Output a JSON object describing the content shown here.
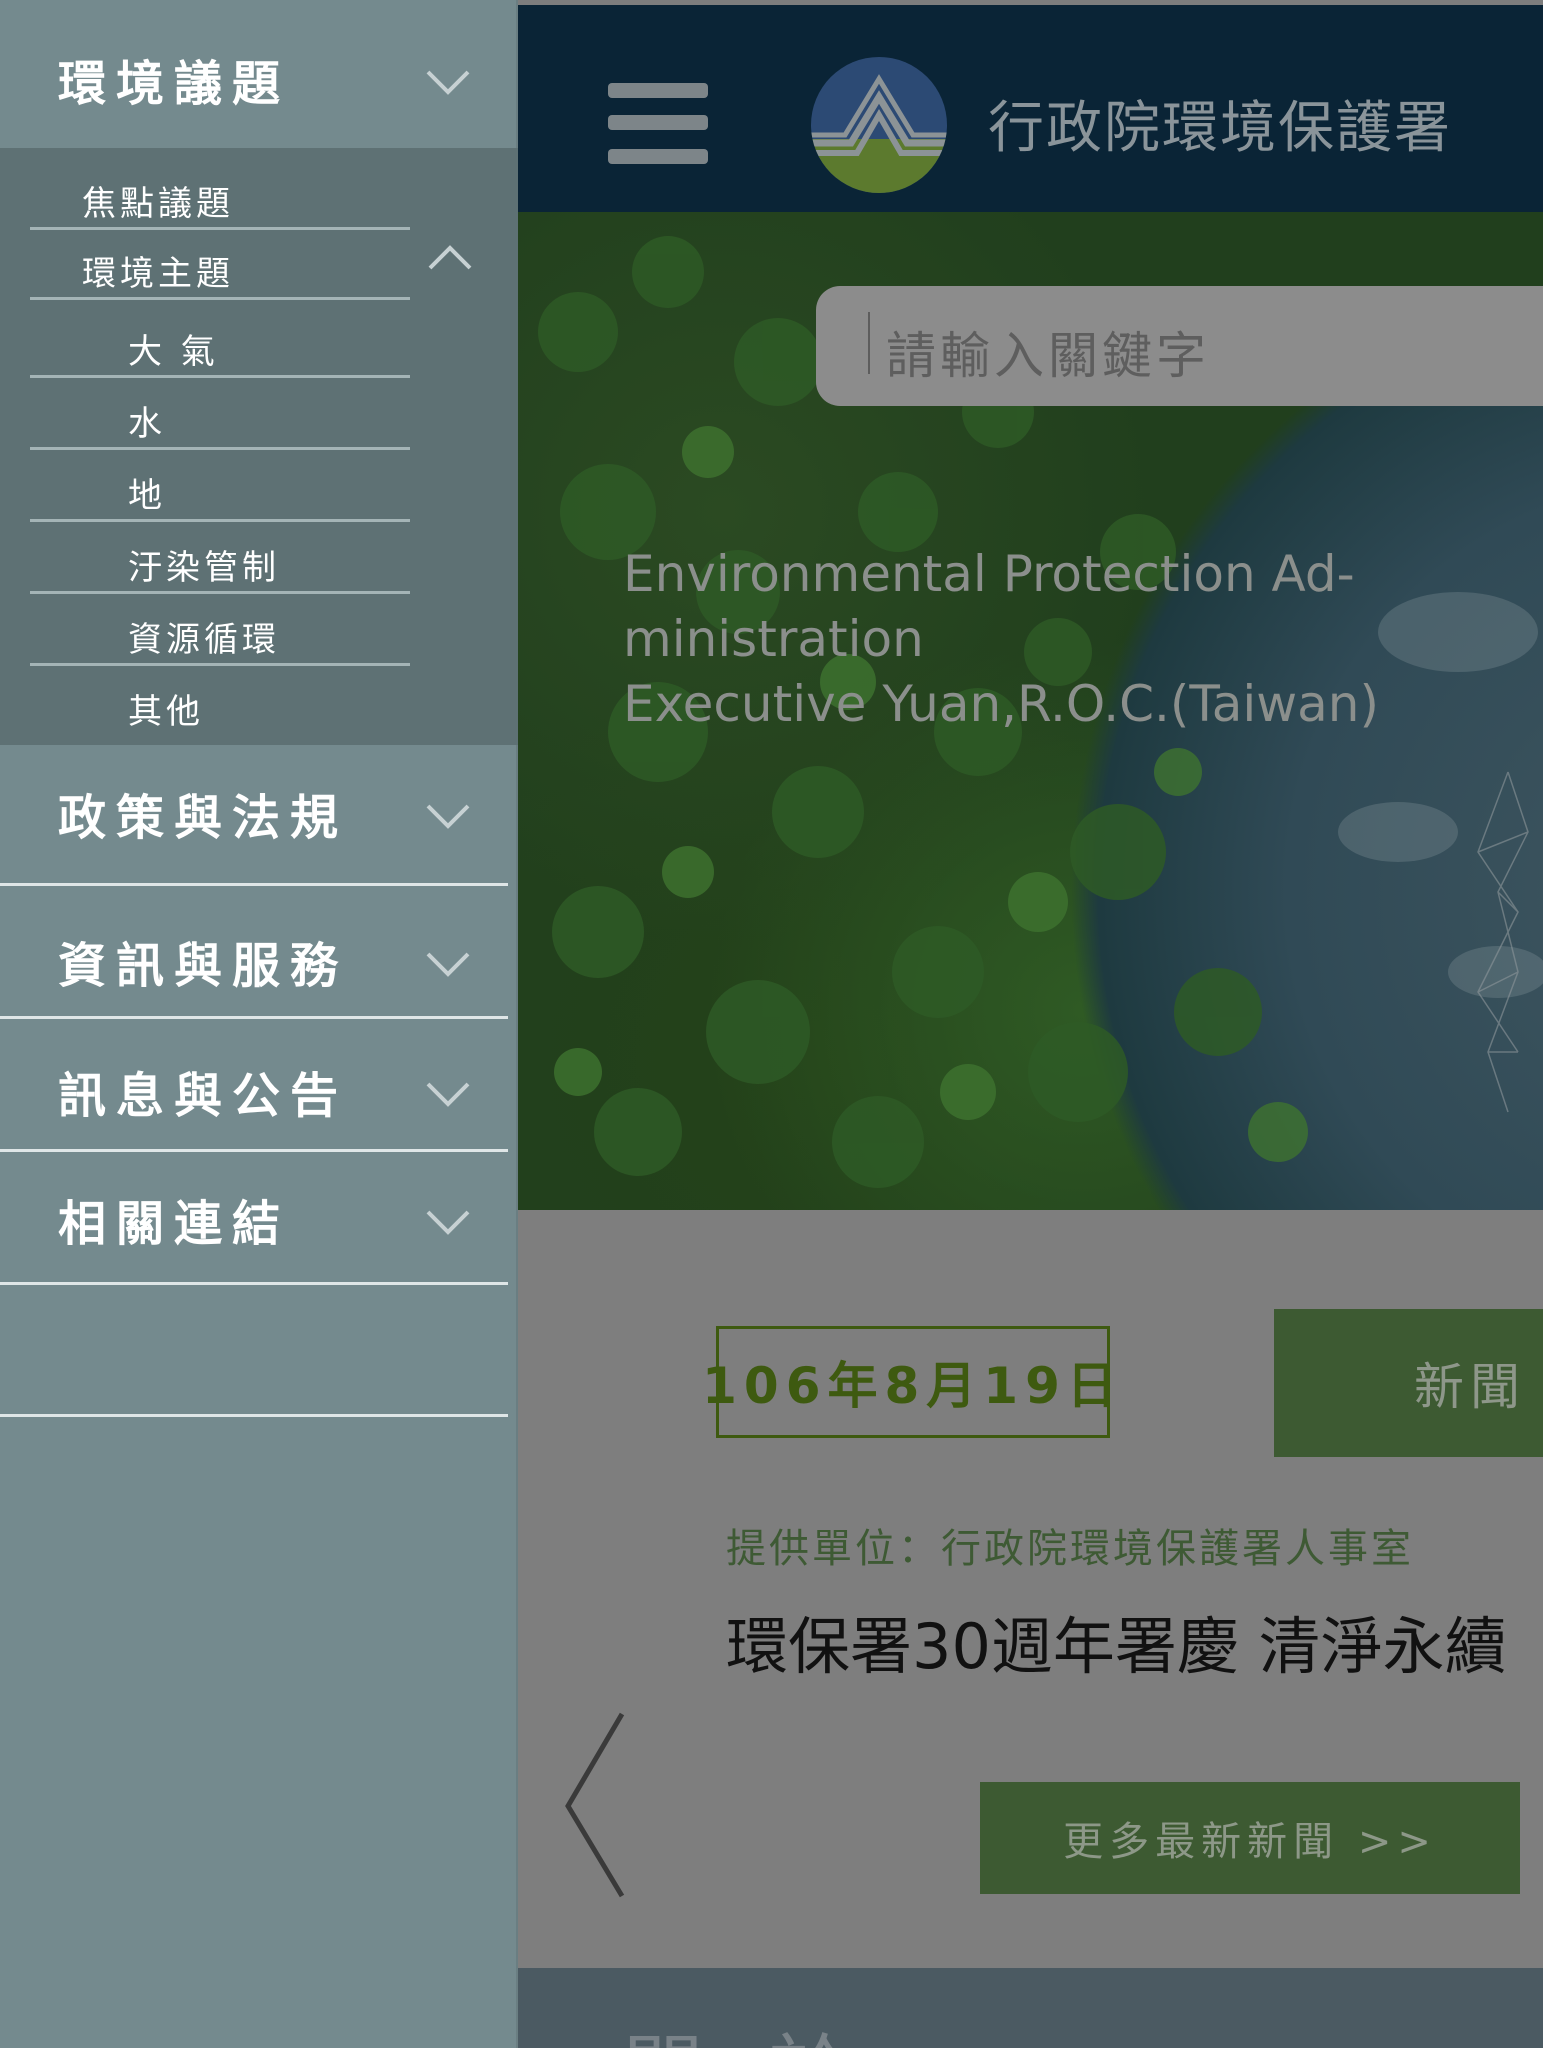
{
  "header": {
    "site_title": "行政院環境保護署"
  },
  "search": {
    "placeholder": "請輸入關鍵字"
  },
  "hero": {
    "lines": [
      "Environmental Protection Ad-",
      "ministration",
      "Executive Yuan,R.O.C.(Taiwan)"
    ]
  },
  "news": {
    "date": "106年8月19日",
    "tag": "新聞",
    "source": "提供單位：行政院環境保護署人事室",
    "headline": "環保署30週年署慶 清淨永續",
    "more_label": "更多最新新聞 >>"
  },
  "bottom_band": {
    "text": "關 於"
  },
  "sidebar": {
    "sections": [
      {
        "label": "環境議題",
        "expanded": true
      },
      {
        "label": "政策與法規",
        "expanded": false
      },
      {
        "label": "資訊與服務",
        "expanded": false
      },
      {
        "label": "訊息與公告",
        "expanded": false
      },
      {
        "label": "相關連結",
        "expanded": false
      }
    ],
    "sub_items": [
      {
        "label": "焦點議題"
      },
      {
        "label": "環境主題",
        "expanded": true
      }
    ],
    "topic_items": [
      {
        "label": "大 氣"
      },
      {
        "label": "水"
      },
      {
        "label": "地"
      },
      {
        "label": "汙染管制"
      },
      {
        "label": "資源循環"
      },
      {
        "label": "其他"
      }
    ]
  },
  "colors": {
    "sidebar_bg": "#748a8e",
    "sidebar_sub_bg": "#5e7174",
    "header_bg": "#0a2436",
    "accent_green": "#3d5a32",
    "date_green": "#3e5a10"
  },
  "icons": {
    "menu": "hamburger-icon",
    "logo": "epa-logo",
    "expand": "chevron-down-icon",
    "collapse": "chevron-up-icon",
    "previous": "chevron-left-icon"
  }
}
